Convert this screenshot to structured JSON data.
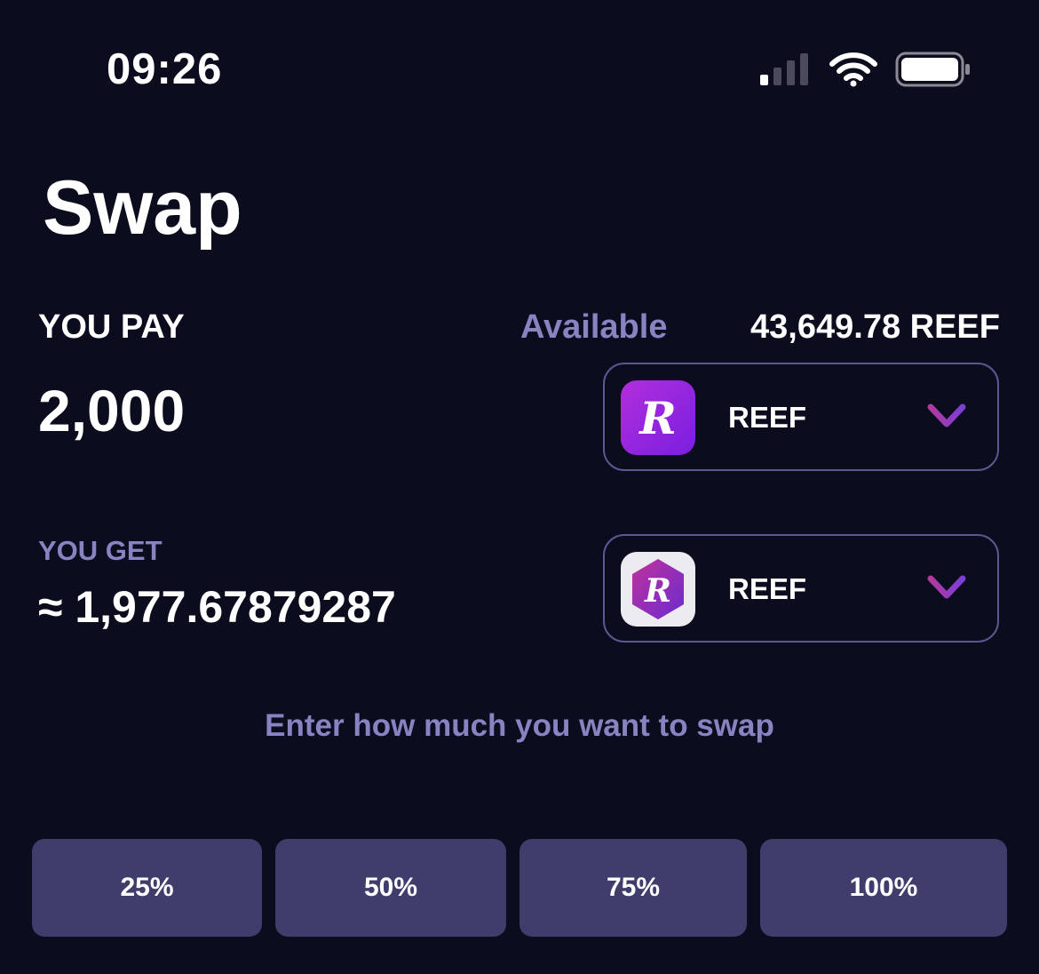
{
  "status_bar": {
    "time": "09:26"
  },
  "page": {
    "title": "Swap"
  },
  "pay": {
    "label": "YOU PAY",
    "amount": "2,000",
    "available_label": "Available",
    "available_value": "43,649.78 REEF",
    "token": {
      "symbol": "REEF",
      "logo_letter": "R",
      "icon": "reef-logo-icon"
    }
  },
  "get": {
    "label": "YOU GET",
    "amount": "≈ 1,977.67879287",
    "token": {
      "symbol": "REEF",
      "logo_letter": "R",
      "icon": "reef-hexagon-logo-icon"
    }
  },
  "hint": "Enter how much you want to swap",
  "percent_buttons": [
    "25%",
    "50%",
    "75%",
    "100%"
  ],
  "colors": {
    "background": "#0c0c1f",
    "muted_label": "#8983c2",
    "button_bg": "#3e3d6b",
    "token_border": "#5a5890",
    "accent_gradient_start": "#b12edc",
    "accent_gradient_end": "#7a1fe0"
  }
}
